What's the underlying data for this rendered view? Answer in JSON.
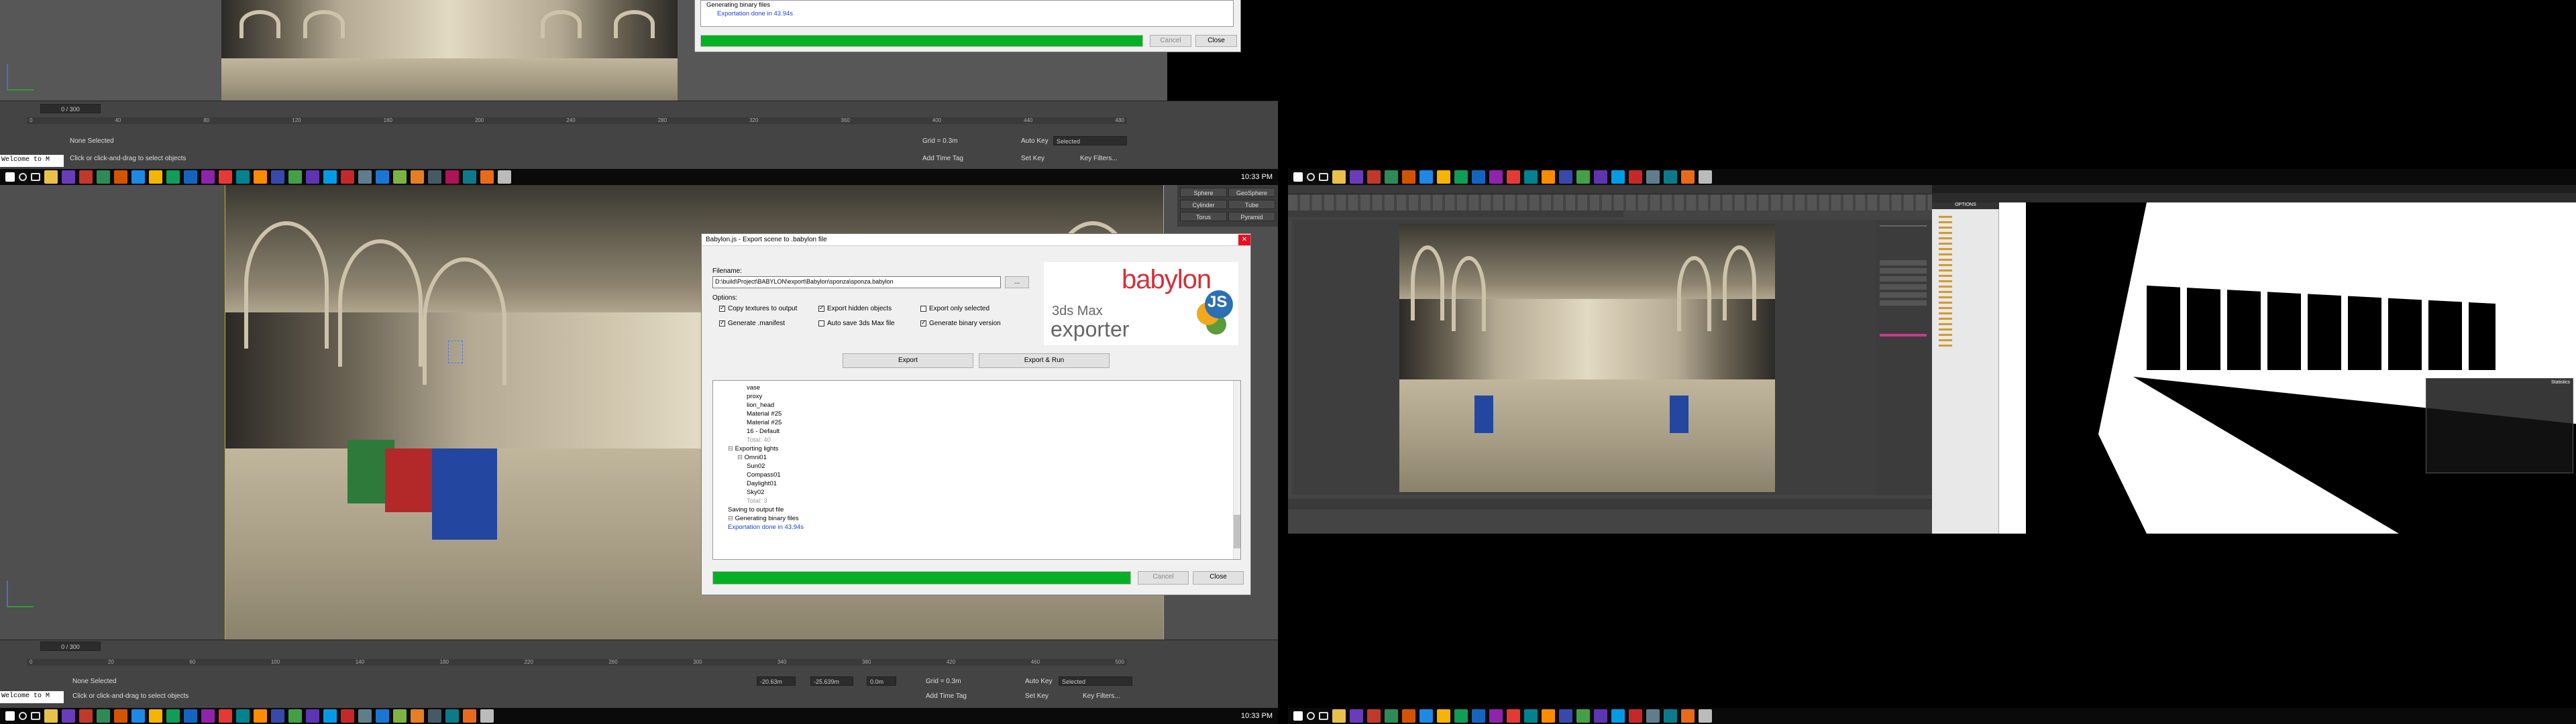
{
  "top": {
    "progress_pct": 100,
    "tree_lines": [
      "Generating binary files",
      "Exportation done in 43.94s"
    ],
    "cancel": "Cancel",
    "close": "Close",
    "frame": "0 / 300",
    "status": "None Selected",
    "hint": "Click or click-and-drag to select objects",
    "grid": "Grid = 0.3m",
    "autokey": "Auto Key",
    "setkey": "Set Key",
    "selected": "Selected",
    "keyfilters": "Key Filters...",
    "addtimetag": "Add Time Tag",
    "welcome": "Welcome to M",
    "clock": "10:33 PM",
    "ruler": [
      "0",
      "20",
      "40",
      "60",
      "80",
      "100",
      "120",
      "140",
      "160",
      "180",
      "200",
      "220",
      "240",
      "260",
      "280",
      "300",
      "320",
      "340",
      "360",
      "380",
      "400",
      "420",
      "440",
      "460",
      "480",
      "500"
    ]
  },
  "dialog": {
    "title": "Babylon.js - Export scene to .babylon file",
    "filename_label": "Filename:",
    "filename": "D:\\build\\Project\\BABYLON\\export\\Babylon\\sponza\\sponza.babylon",
    "browse": "...",
    "options_label": "Options:",
    "opts": [
      {
        "label": "Copy textures to output",
        "on": true
      },
      {
        "label": "Export hidden objects",
        "on": true
      },
      {
        "label": "Export only selected",
        "on": false
      },
      {
        "label": "Generate .manifest",
        "on": true
      },
      {
        "label": "Auto save 3ds Max file",
        "on": false
      },
      {
        "label": "Generate binary version",
        "on": true
      }
    ],
    "logo_top": "babylon",
    "logo_js": "JS",
    "logo_sub1": "3ds Max",
    "logo_sub2": "exporter",
    "export": "Export",
    "export_run": "Export & Run",
    "tree": [
      {
        "t": "vase",
        "i": 3
      },
      {
        "t": "proxy",
        "i": 3
      },
      {
        "t": "lion_head",
        "i": 3
      },
      {
        "t": "Material #25",
        "i": 3
      },
      {
        "t": "Material #25",
        "i": 3
      },
      {
        "t": "16 - Default",
        "i": 3
      },
      {
        "t": "Total: 40",
        "i": 3,
        "g": true
      },
      {
        "t": "Exporting lights",
        "i": 1,
        "e": true
      },
      {
        "t": "Omni01",
        "i": 2,
        "e": true
      },
      {
        "t": "Sun02",
        "i": 3
      },
      {
        "t": "Compass01",
        "i": 3
      },
      {
        "t": "Daylight01",
        "i": 3
      },
      {
        "t": "Sky02",
        "i": 3
      },
      {
        "t": "Total: 3",
        "i": 3,
        "g": true
      },
      {
        "t": "Saving to output file",
        "i": 1
      },
      {
        "t": "Generating binary files",
        "i": 1,
        "e": true
      },
      {
        "t": "Exportation done in 43.94s",
        "i": 1,
        "b": true
      }
    ],
    "cancel": "Cancel",
    "close": "Close",
    "progress_pct": 100
  },
  "cmd_panel": [
    "Sphere",
    "GeoSphere",
    "Cylinder",
    "Tube",
    "Torus",
    "Pyramid"
  ],
  "bottom": {
    "frame": "0 / 300",
    "status": "None Selected",
    "hint": "Click or click-and-drag to select objects",
    "x": "-20.63m",
    "y": "-25.639m",
    "z": "0.0m",
    "grid": "Grid = 0.3m",
    "autokey": "Auto Key",
    "selected": "Selected",
    "setkey": "Set Key",
    "keyfilters": "Key Filters...",
    "addtimetag": "Add Time Tag",
    "welcome": "Welcome to M",
    "clock": "10:33 PM",
    "ruler": [
      "0",
      "10",
      "20",
      "40",
      "60",
      "80",
      "100",
      "120",
      "140",
      "160",
      "180",
      "200",
      "220",
      "240",
      "260",
      "280",
      "300",
      "320",
      "340",
      "360",
      "380",
      "400",
      "420",
      "440",
      "460",
      "480",
      "500"
    ]
  },
  "right": {
    "clock": "10:33 PM",
    "browser_title": "OPTIONS",
    "stats_title": "Statistics"
  },
  "colors": {
    "taskbar": "#0a0a0a",
    "max_bg": "#444444",
    "viewport_border": "#c8b400",
    "progress": "#06b025",
    "babylon_red": "#d42f3a"
  }
}
